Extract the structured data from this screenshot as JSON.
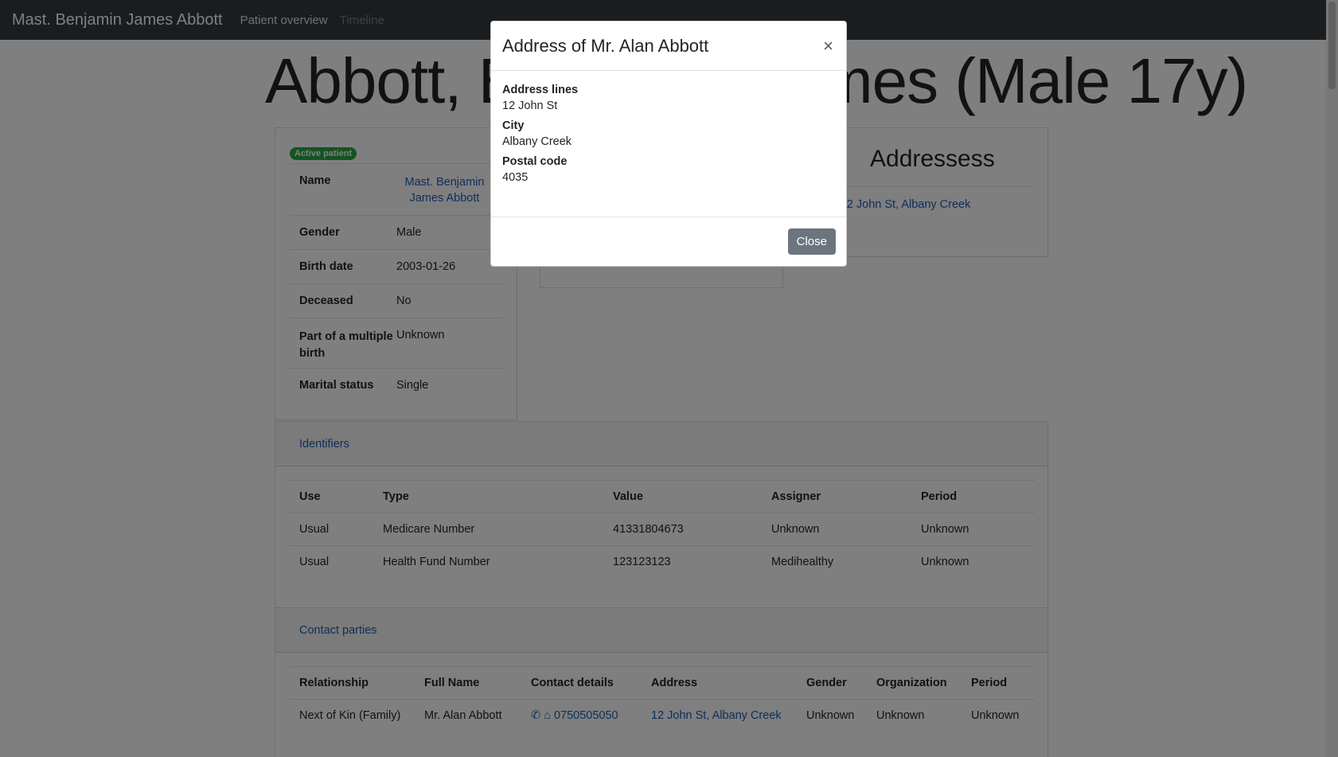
{
  "navbar": {
    "brand": "Mast. Benjamin James Abbott",
    "links": [
      "Patient overview",
      "Timeline"
    ]
  },
  "page_title": "Abbott, Benjamin James (Male 17y)",
  "patient": {
    "badge": "Active patient",
    "fields": [
      {
        "key": "Name",
        "value": "Mast. Benjamin James Abbott"
      },
      {
        "key": "Gender",
        "value": "Male"
      },
      {
        "key": "Birth date",
        "value": "2003-01-26"
      },
      {
        "key": "Deceased",
        "value": "No"
      },
      {
        "key": "Part of a multiple birth",
        "value": "Unknown"
      },
      {
        "key": "Marital status",
        "value": "Single"
      }
    ]
  },
  "addresses": {
    "title": "Addressess",
    "item": "12 John St, Albany Creek",
    "item_icon": "building-icon"
  },
  "identifiers": {
    "header": "Identifiers",
    "columns": [
      "Use",
      "Type",
      "Value",
      "Assigner",
      "Period"
    ],
    "rows": [
      [
        "Usual",
        "Medicare Number",
        "41331804673",
        "Unknown",
        "Unknown"
      ],
      [
        "Usual",
        "Health Fund Number",
        "123123123",
        "Medihealthy",
        "Unknown"
      ]
    ]
  },
  "contacts": {
    "header": "Contact parties",
    "columns": [
      "Relationship",
      "Full Name",
      "Contact details",
      "Address",
      "Gender",
      "Organization",
      "Period"
    ],
    "rows": [
      {
        "relationship": "Next of Kin (Family)",
        "name": "Mr. Alan Abbott",
        "phone": "0750505050",
        "address": "12 John St, Albany Creek",
        "gender": "Unknown",
        "organization": "Unknown",
        "period": "Unknown"
      }
    ]
  },
  "modal": {
    "title": "Address of Mr. Alan Abbott",
    "close_symbol": "×",
    "fields": [
      {
        "label": "Address lines",
        "value": "12 John St"
      },
      {
        "label": "City",
        "value": "Albany Creek"
      },
      {
        "label": "Postal code",
        "value": "4035"
      }
    ],
    "close_label": "Close"
  },
  "colors": {
    "navbar": "#343a40",
    "link": "#1b5fb6",
    "badge": "#28a745",
    "close_button": "#6c757d"
  }
}
